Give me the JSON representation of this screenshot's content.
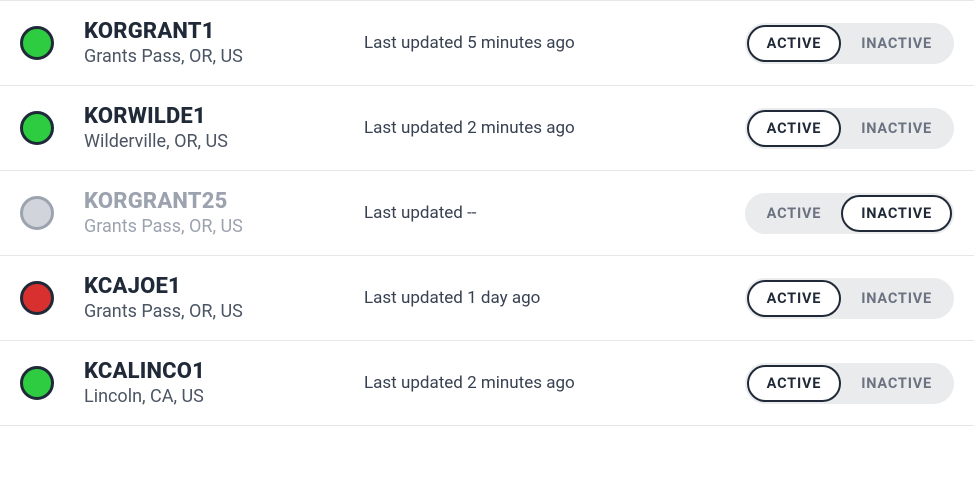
{
  "labels": {
    "active": "ACTIVE",
    "inactive": "INACTIVE"
  },
  "stations": [
    {
      "id": "KORGRANT1",
      "location": "Grants Pass, OR, US",
      "updated": "Last updated 5 minutes ago",
      "dot_color": "green",
      "selected": "active",
      "disabled": false
    },
    {
      "id": "KORWILDE1",
      "location": "Wilderville, OR, US",
      "updated": "Last updated 2 minutes ago",
      "dot_color": "green",
      "selected": "active",
      "disabled": false
    },
    {
      "id": "KORGRANT25",
      "location": "Grants Pass, OR, US",
      "updated": "Last updated --",
      "dot_color": "gray",
      "selected": "inactive",
      "disabled": true
    },
    {
      "id": "KCAJOE1",
      "location": "Grants Pass, OR, US",
      "updated": "Last updated 1 day ago",
      "dot_color": "red",
      "selected": "active",
      "disabled": false
    },
    {
      "id": "KCALINCO1",
      "location": "Lincoln, CA, US",
      "updated": "Last updated 2 minutes ago",
      "dot_color": "green",
      "selected": "active",
      "disabled": false
    }
  ]
}
